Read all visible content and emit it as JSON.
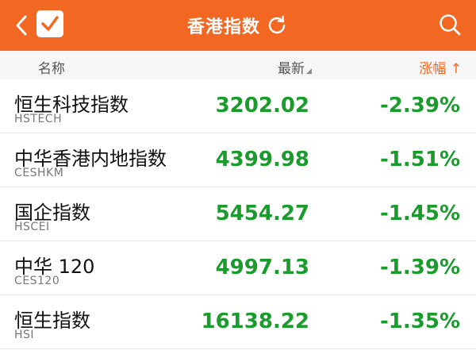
{
  "header": {
    "title": "香港指数"
  },
  "columns": {
    "name": "名称",
    "latest": "最新",
    "change": "涨幅",
    "change_arrow": "↑"
  },
  "rows": [
    {
      "name": "恒生科技指数",
      "code": "HSTECH",
      "price": "3202.02",
      "change": "-2.39%"
    },
    {
      "name": "中华香港内地指数",
      "code": "CESHKM",
      "price": "4399.98",
      "change": "-1.51%"
    },
    {
      "name": "国企指数",
      "code": "HSCEI",
      "price": "5454.27",
      "change": "-1.45%"
    },
    {
      "name": "中华 120",
      "code": "CES120",
      "price": "4997.13",
      "change": "-1.39%"
    },
    {
      "name": "恒生指数",
      "code": "HSI",
      "price": "16138.22",
      "change": "-1.35%"
    }
  ],
  "colors": {
    "accent": "#f26722",
    "down": "#1a9c2c"
  }
}
